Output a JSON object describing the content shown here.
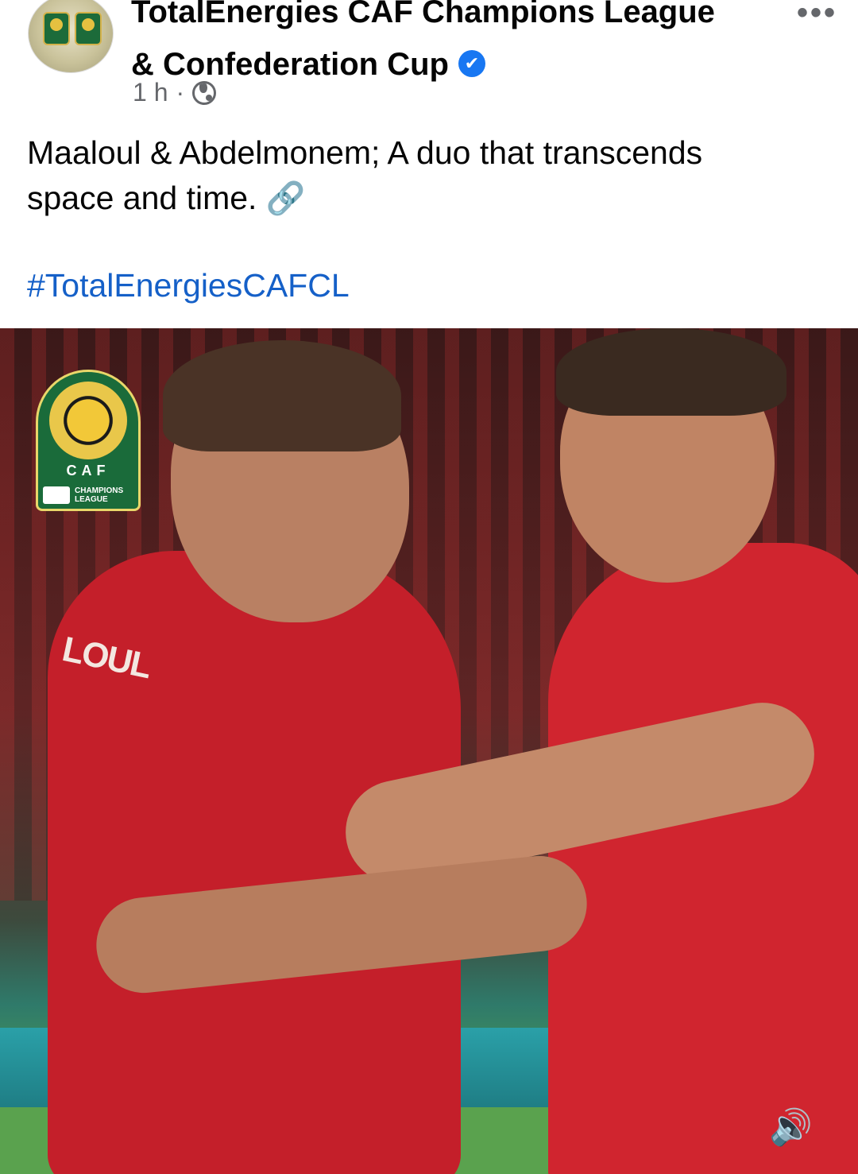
{
  "post": {
    "page_name_line1": "TotalEnergies CAF Champions League",
    "page_name_line2": "& Confederation Cup",
    "verified_glyph": "✔",
    "more_glyph": "•••",
    "time": "1 h",
    "separator": "·",
    "privacy_icon": "globe-icon",
    "text_line1": "Maaloul & Abdelmonem; A duo that transcends",
    "text_line2": "space and time.",
    "link_emoji": "🔗",
    "hashtag": "#TotalEnergiesCAFCL"
  },
  "media": {
    "logo": {
      "caf_text": "CAF",
      "competition_line1": "CHAMPIONS",
      "competition_line2": "LEAGUE"
    },
    "jersey_text": "LOUL",
    "volume_glyph": "🔊"
  },
  "colors": {
    "verified_blue": "#1877f2",
    "hashtag_blue": "#1560c8",
    "meta_gray": "#65676b",
    "jersey_red": "#c41f2a"
  }
}
